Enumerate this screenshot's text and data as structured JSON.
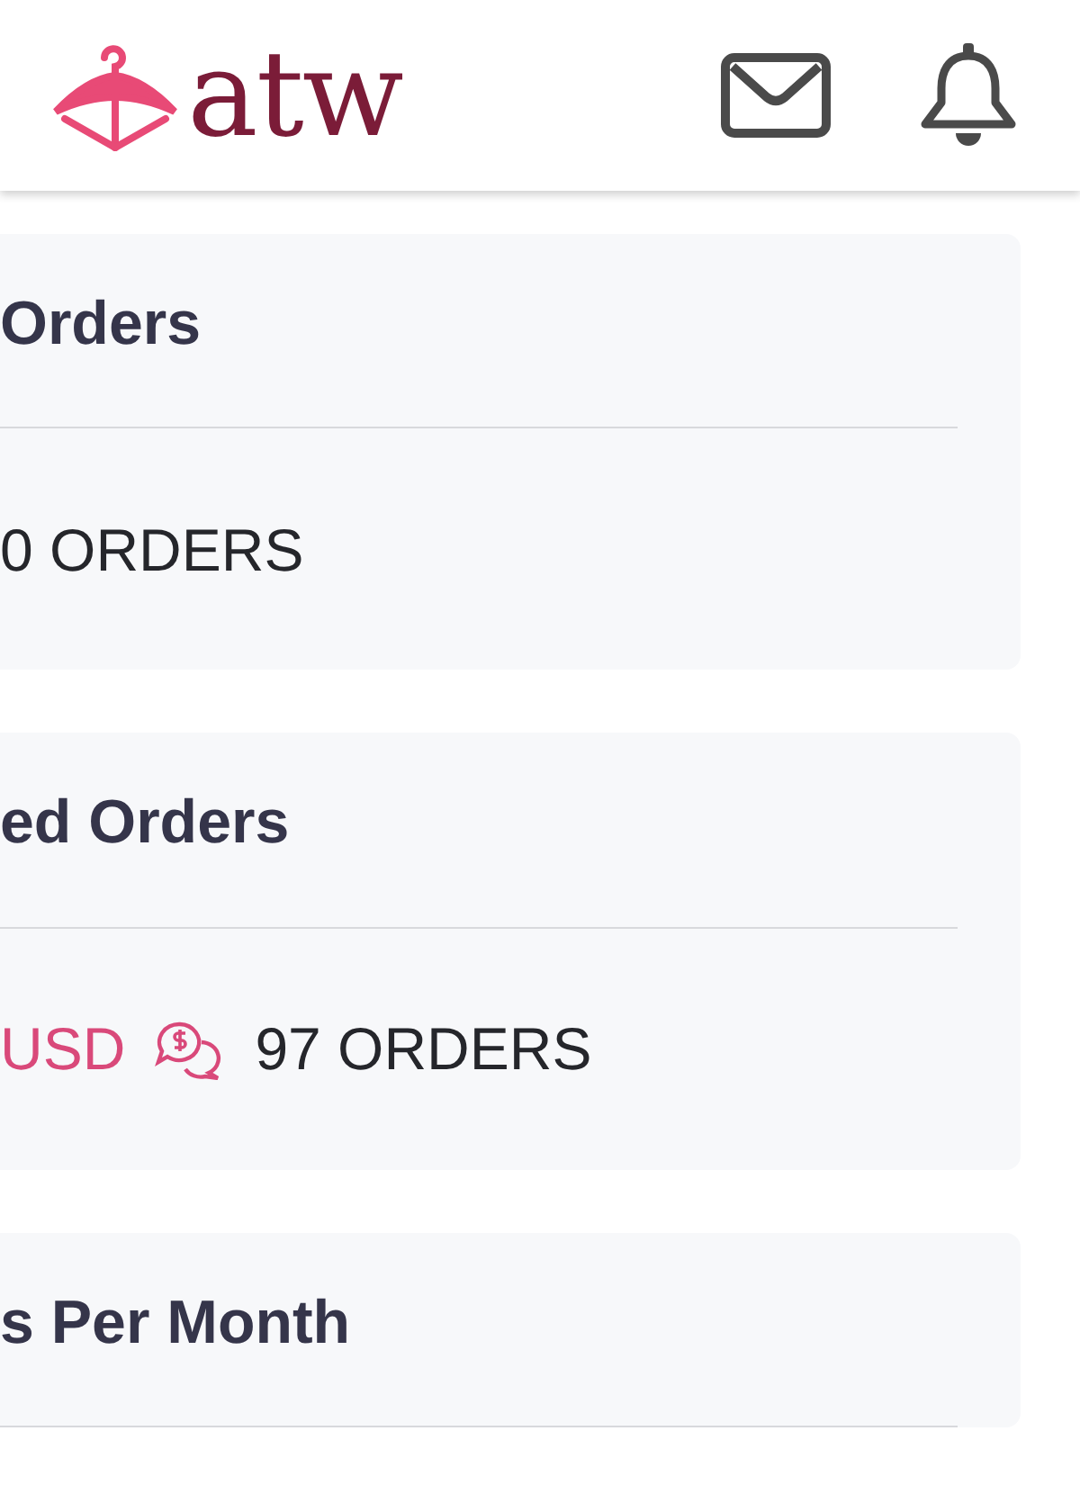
{
  "header": {
    "logo_text": "atw"
  },
  "cards": [
    {
      "title": "Orders",
      "stats": [
        {
          "kind": "orders",
          "text": "0 ORDERS",
          "icon": false
        }
      ]
    },
    {
      "title": "ed Orders",
      "stats": [
        {
          "kind": "amount",
          "text": "USD"
        },
        {
          "kind": "orders",
          "text": "97 ORDERS",
          "icon": true
        }
      ]
    },
    {
      "title": "s Per Month"
    }
  ]
}
